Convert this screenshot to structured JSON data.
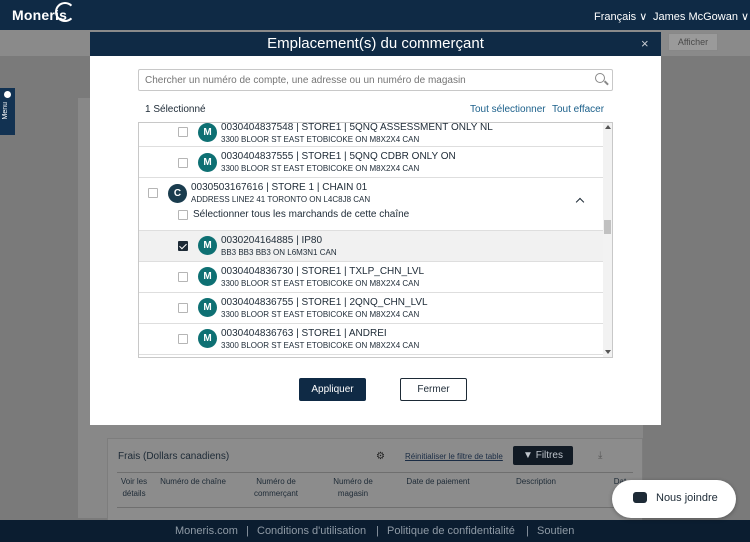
{
  "topbar": {
    "brand": "Moneris",
    "language": "Français ∨",
    "user": "James McGowan ∨"
  },
  "subbar": {
    "show_button": "Afficher"
  },
  "side_menu": {
    "label": "Menu"
  },
  "modal": {
    "title": "Emplacement(s) du commerçant",
    "close_icon": "×",
    "search_placeholder": "Chercher un numéro de compte, une adresse ou un numéro de magasin",
    "selected_count": "1 Sélectionné",
    "select_all": "Tout sélectionner",
    "clear_all": "Tout effacer",
    "apply_button": "Appliquer",
    "close_button": "Fermer",
    "items": [
      {
        "badge": "M",
        "checked": false,
        "title": "0030404837548 | STORE1 | 5QNQ ASSESSMENT ONLY NL",
        "address": "3300 BLOOR ST EAST ETOBICOKE ON M8X2X4 CAN"
      },
      {
        "badge": "M",
        "checked": false,
        "title": "0030404837555 | STORE1 | 5QNQ CDBR ONLY ON",
        "address": "3300 BLOOR ST EAST ETOBICOKE ON M8X2X4 CAN"
      },
      {
        "badge": "C",
        "checked": false,
        "title": "0030503167616 | STORE 1 | CHAIN 01",
        "address": "ADDRESS LINE2 41 TORONTO ON L4C8J8 CAN",
        "chain_select": "Sélectionner tous les marchands de cette chaîne"
      },
      {
        "badge": "M",
        "checked": true,
        "title": "0030204164885 | IP80",
        "address": "BB3 BB3 BB3 ON L6M3N1 CAN"
      },
      {
        "badge": "M",
        "checked": false,
        "title": "0030404836730 | STORE1 | TXLP_CHN_LVL",
        "address": "3300 BLOOR ST EAST ETOBICOKE ON M8X2X4 CAN"
      },
      {
        "badge": "M",
        "checked": false,
        "title": "0030404836755 | STORE1 | 2QNQ_CHN_LVL",
        "address": "3300 BLOOR ST EAST ETOBICOKE ON M8X2X4 CAN"
      },
      {
        "badge": "M",
        "checked": false,
        "title": "0030404836763 | STORE1 | ANDREI",
        "address": "3300 BLOOR ST EAST ETOBICOKE ON M8X2X4 CAN"
      }
    ]
  },
  "fees": {
    "title": "Frais (Dollars canadiens)",
    "reset_filter": "Réinitialiser le filtre de table",
    "filters_button": "Filtres",
    "columns": [
      "Voir les détails",
      "Numéro de chaîne",
      "Numéro de commerçant",
      "Numéro de magasin",
      "Date de paiement",
      "Description",
      "Dat"
    ]
  },
  "chat": {
    "label": "Nous joindre"
  },
  "footer": {
    "links": [
      "Moneris.com",
      "Conditions d'utilisation",
      "Politique de confidentialité",
      "Soutien"
    ],
    "separator": "|"
  },
  "colors": {
    "navy": "#0f2a45",
    "teal_badge": "#0e7073",
    "link_blue": "#1a5f8a"
  }
}
